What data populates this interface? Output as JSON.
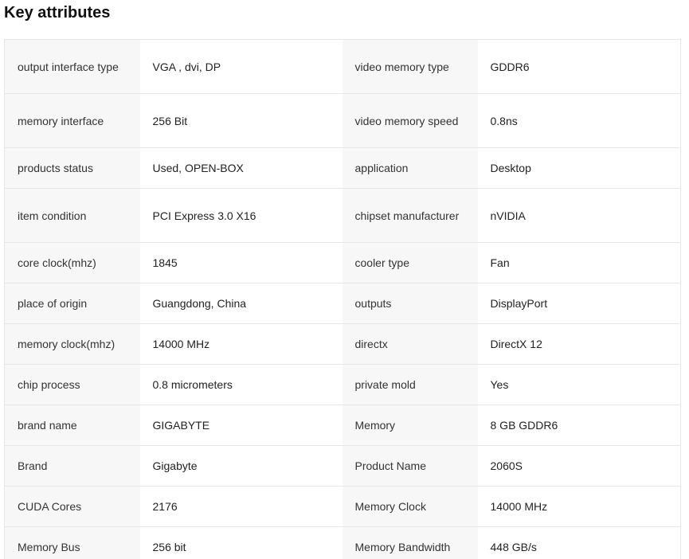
{
  "section": {
    "title": "Key attributes"
  },
  "rows": [
    {
      "l1": "output interface type",
      "v1": "VGA , dvi, DP",
      "l2": "video memory type",
      "v2": "GDDR6",
      "tall": true
    },
    {
      "l1": "memory interface",
      "v1": "256 Bit",
      "l2": "video memory speed",
      "v2": "0.8ns",
      "tall": true
    },
    {
      "l1": "products status",
      "v1": "Used, OPEN-BOX",
      "l2": "application",
      "v2": "Desktop",
      "tall": false
    },
    {
      "l1": "item condition",
      "v1": "PCI Express 3.0 X16",
      "l2": "chipset manufacturer",
      "v2": "nVIDIA",
      "tall": true
    },
    {
      "l1": "core clock(mhz)",
      "v1": "1845",
      "l2": "cooler type",
      "v2": "Fan",
      "tall": false
    },
    {
      "l1": "place of origin",
      "v1": "Guangdong, China",
      "l2": "outputs",
      "v2": "DisplayPort",
      "tall": false
    },
    {
      "l1": "memory clock(mhz)",
      "v1": "14000 MHz",
      "l2": "directx",
      "v2": "DirectX 12",
      "tall": false
    },
    {
      "l1": "chip process",
      "v1": "0.8 micrometers",
      "l2": "private mold",
      "v2": "Yes",
      "tall": false
    },
    {
      "l1": "brand name",
      "v1": "GIGABYTE",
      "l2": "Memory",
      "v2": "8 GB GDDR6",
      "tall": false
    },
    {
      "l1": "Brand",
      "v1": "Gigabyte",
      "l2": "Product Name",
      "v2": "2060S",
      "tall": false
    },
    {
      "l1": "CUDA Cores",
      "v1": "2176",
      "l2": "Memory Clock",
      "v2": "14000 MHz",
      "tall": false
    },
    {
      "l1": "Memory Bus",
      "v1": "256 bit",
      "l2": "Memory Bandwidth",
      "v2": "448 GB/s",
      "tall": false
    }
  ]
}
